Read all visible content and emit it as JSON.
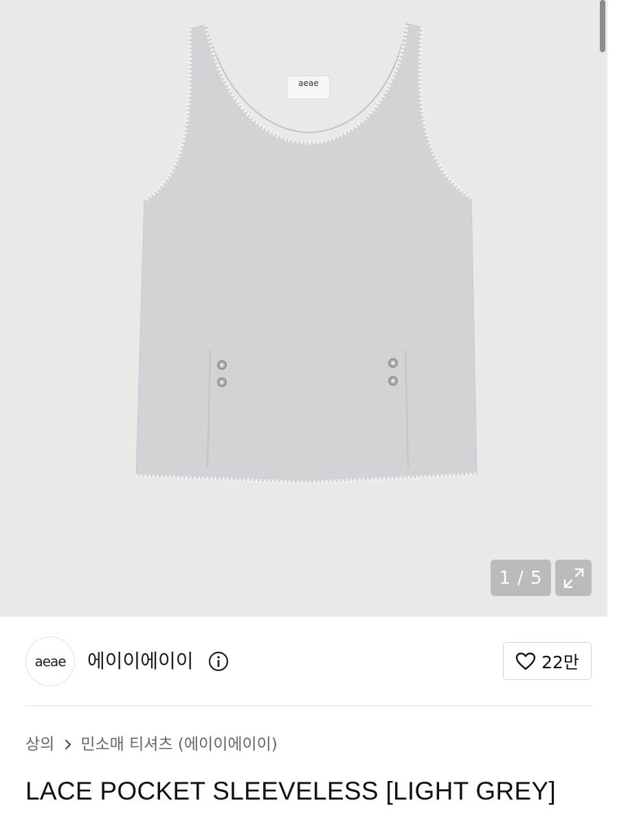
{
  "gallery": {
    "image_alt": "LACE POCKET SLEEVELESS light grey tank top",
    "tag_text": "aeae",
    "counter": "1 / 5",
    "expand_icon": "expand-icon"
  },
  "brand": {
    "logo_text": "aeae",
    "name": "에이이에이이",
    "info_icon": "info-icon",
    "like_icon": "heart-icon",
    "like_count": "22만"
  },
  "breadcrumb": {
    "category": "상의",
    "separator_icon": "chevron-right-icon",
    "subcategory": "민소매 티셔츠 (에이이에이이)"
  },
  "product": {
    "title": "LACE POCKET SLEEVELESS [LIGHT GREY]"
  }
}
